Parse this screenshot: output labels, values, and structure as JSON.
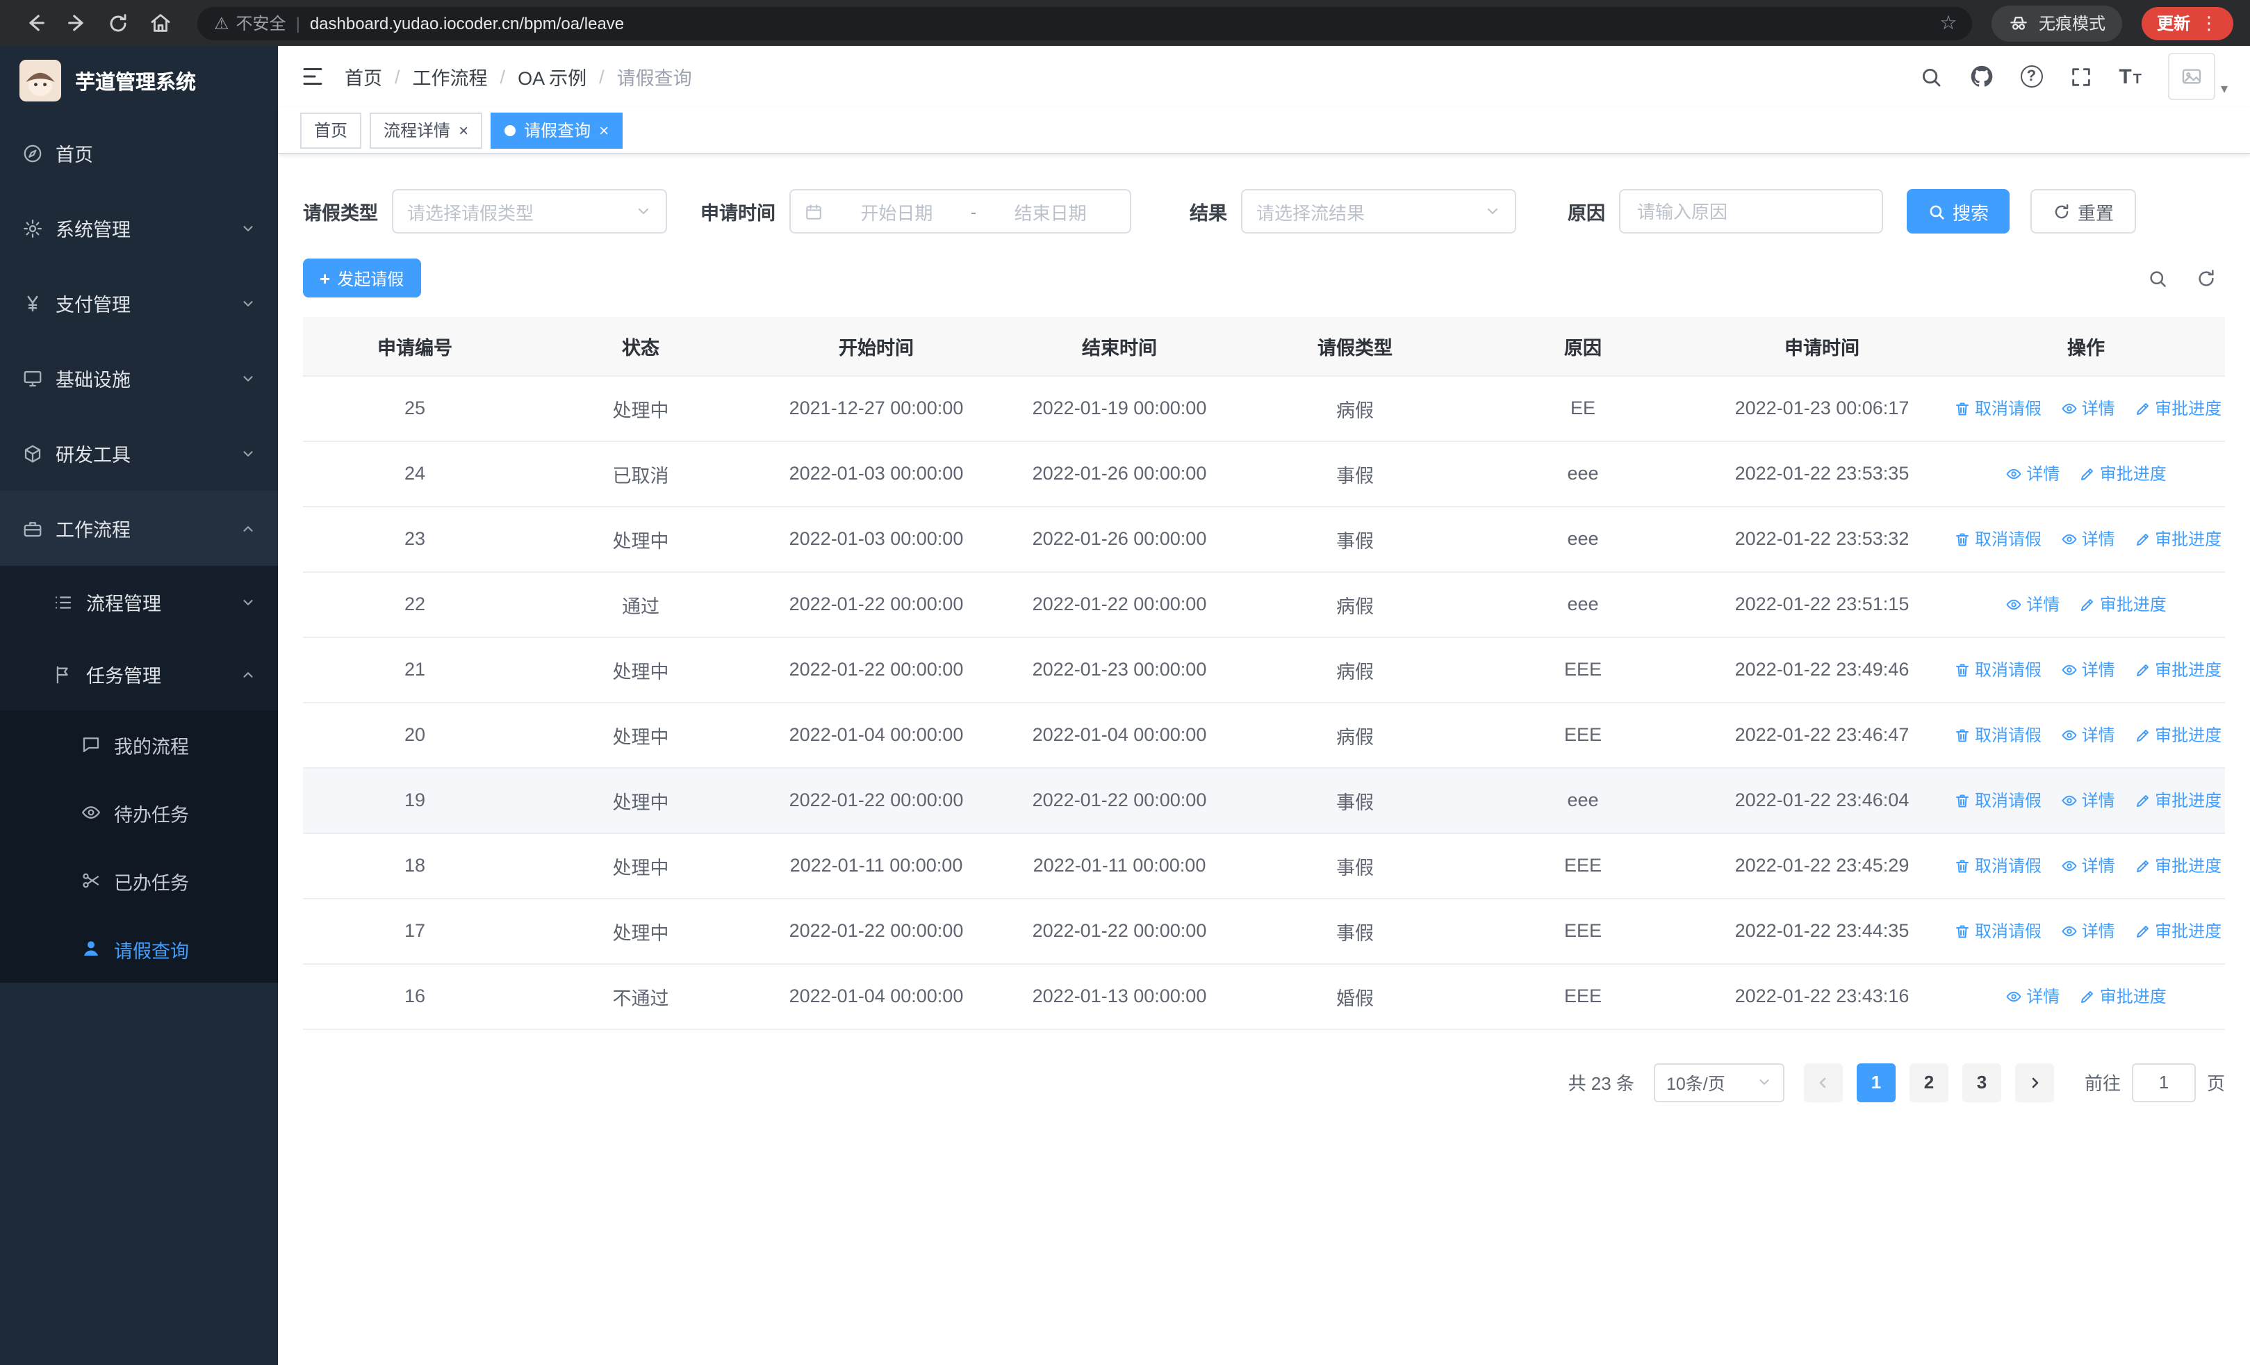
{
  "browser": {
    "security_label": "不安全",
    "url": "dashboard.yudao.iocoder.cn/bpm/oa/leave",
    "incognito_label": "无痕模式",
    "update_label": "更新"
  },
  "icons": {
    "warning": "⚠",
    "star": "☆",
    "separator": "|",
    "dots": "⋮",
    "caret": "▾",
    "question": "?",
    "font_large": "T",
    "font_small": "T",
    "close": "×",
    "plus": "+",
    "breadcrumb_sep": "/"
  },
  "sidebar": {
    "logo_title": "芋道管理系统",
    "items": [
      {
        "label": "首页"
      },
      {
        "label": "系统管理"
      },
      {
        "label": "支付管理"
      },
      {
        "label": "基础设施"
      },
      {
        "label": "研发工具"
      },
      {
        "label": "工作流程"
      },
      {
        "label": "流程管理"
      },
      {
        "label": "任务管理"
      },
      {
        "label": "我的流程"
      },
      {
        "label": "待办任务"
      },
      {
        "label": "已办任务"
      },
      {
        "label": "请假查询"
      }
    ]
  },
  "breadcrumb": {
    "items": [
      {
        "label": "首页"
      },
      {
        "label": "工作流程",
        "sep": true
      },
      {
        "label": "OA 示例",
        "sep": true
      },
      {
        "label": "请假查询",
        "sep": true,
        "muted": true
      }
    ]
  },
  "tabs": {
    "items": [
      {
        "label": "首页"
      },
      {
        "label": "流程详情",
        "closable": true
      },
      {
        "label": "请假查询",
        "closable": true,
        "active": true
      }
    ]
  },
  "filters": {
    "type_label": "请假类型",
    "type_placeholder": "请选择请假类型",
    "time_label": "申请时间",
    "start_placeholder": "开始日期",
    "range_separator": "-",
    "end_placeholder": "结束日期",
    "result_label": "结果",
    "result_placeholder": "请选择流结果",
    "reason_label": "原因",
    "reason_placeholder": "请输入原因",
    "search_label": "搜索",
    "reset_label": "重置"
  },
  "toolbar": {
    "create_label": "发起请假"
  },
  "table": {
    "columns": [
      "申请编号",
      "状态",
      "开始时间",
      "结束时间",
      "请假类型",
      "原因",
      "申请时间",
      "操作"
    ],
    "ops": {
      "cancel": "取消请假",
      "detail": "详情",
      "progress": "审批进度"
    },
    "rows": [
      {
        "id": "25",
        "status": "处理中",
        "start": "2021-12-27 00:00:00",
        "end": "2022-01-19 00:00:00",
        "type": "病假",
        "reason": "EE",
        "applied": "2022-01-23 00:06:17",
        "cancelable": true
      },
      {
        "id": "24",
        "status": "已取消",
        "start": "2022-01-03 00:00:00",
        "end": "2022-01-26 00:00:00",
        "type": "事假",
        "reason": "eee",
        "applied": "2022-01-22 23:53:35",
        "cancelable": false
      },
      {
        "id": "23",
        "status": "处理中",
        "start": "2022-01-03 00:00:00",
        "end": "2022-01-26 00:00:00",
        "type": "事假",
        "reason": "eee",
        "applied": "2022-01-22 23:53:32",
        "cancelable": true
      },
      {
        "id": "22",
        "status": "通过",
        "start": "2022-01-22 00:00:00",
        "end": "2022-01-22 00:00:00",
        "type": "病假",
        "reason": "eee",
        "applied": "2022-01-22 23:51:15",
        "cancelable": false
      },
      {
        "id": "21",
        "status": "处理中",
        "start": "2022-01-22 00:00:00",
        "end": "2022-01-23 00:00:00",
        "type": "病假",
        "reason": "EEE",
        "applied": "2022-01-22 23:49:46",
        "cancelable": true
      },
      {
        "id": "20",
        "status": "处理中",
        "start": "2022-01-04 00:00:00",
        "end": "2022-01-04 00:00:00",
        "type": "病假",
        "reason": "EEE",
        "applied": "2022-01-22 23:46:47",
        "cancelable": true
      },
      {
        "id": "19",
        "status": "处理中",
        "start": "2022-01-22 00:00:00",
        "end": "2022-01-22 00:00:00",
        "type": "事假",
        "reason": "eee",
        "applied": "2022-01-22 23:46:04",
        "cancelable": true,
        "hover": true
      },
      {
        "id": "18",
        "status": "处理中",
        "start": "2022-01-11 00:00:00",
        "end": "2022-01-11 00:00:00",
        "type": "事假",
        "reason": "EEE",
        "applied": "2022-01-22 23:45:29",
        "cancelable": true
      },
      {
        "id": "17",
        "status": "处理中",
        "start": "2022-01-22 00:00:00",
        "end": "2022-01-22 00:00:00",
        "type": "事假",
        "reason": "EEE",
        "applied": "2022-01-22 23:44:35",
        "cancelable": true
      },
      {
        "id": "16",
        "status": "不通过",
        "start": "2022-01-04 00:00:00",
        "end": "2022-01-13 00:00:00",
        "type": "婚假",
        "reason": "EEE",
        "applied": "2022-01-22 23:43:16",
        "cancelable": false
      }
    ]
  },
  "pagination": {
    "total": "共 23 条",
    "page_size": "10条/页",
    "pages": [
      {
        "n": "1",
        "active": true
      },
      {
        "n": "2"
      },
      {
        "n": "3"
      }
    ],
    "goto_label": "前往",
    "goto_value": "1",
    "page_unit": "页"
  }
}
